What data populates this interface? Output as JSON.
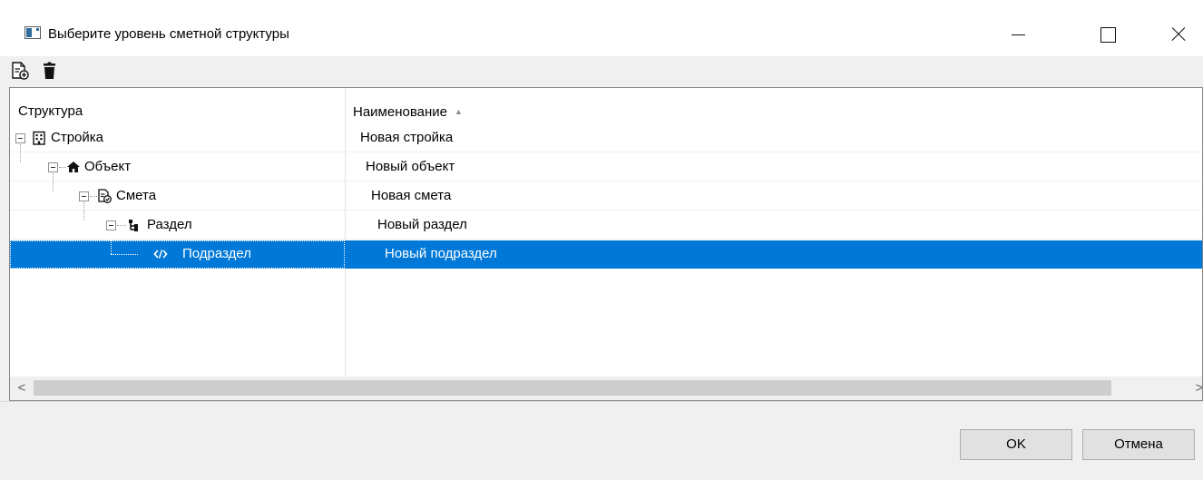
{
  "window": {
    "title": "Выберите уровень сметной структуры",
    "controls": [
      "minimize",
      "maximize",
      "close"
    ]
  },
  "toolbar": {
    "buttons": [
      {
        "icon": "add-document-icon"
      },
      {
        "icon": "trash-icon"
      }
    ]
  },
  "tree": {
    "columns": [
      "Структура",
      "Наименование"
    ],
    "sort_indicator": "▲",
    "rows": [
      {
        "level": 0,
        "structure": "Стройка",
        "name": "Новая стройка",
        "icon": "building-icon",
        "expanded": true,
        "selected": false
      },
      {
        "level": 1,
        "structure": "Объект",
        "name": "Новый объект",
        "icon": "house-icon",
        "expanded": true,
        "selected": false
      },
      {
        "level": 2,
        "structure": "Смета",
        "name": "Новая смета",
        "icon": "estimate-document-icon",
        "expanded": true,
        "selected": false
      },
      {
        "level": 3,
        "structure": "Раздел",
        "name": "Новый раздел",
        "icon": "hierarchy-icon",
        "expanded": true,
        "selected": false
      },
      {
        "level": 4,
        "structure": "Подраздел",
        "name": "Новый подраздел",
        "icon": "code-brackets-icon",
        "expanded": false,
        "selected": true
      }
    ]
  },
  "scrollbar": {
    "left_arrow": "<",
    "right_arrow": ">"
  },
  "buttons": {
    "ok": "OK",
    "cancel": "Отмена"
  },
  "colors": {
    "selection": "#0078d7",
    "window_bg": "#f0f0f0"
  }
}
